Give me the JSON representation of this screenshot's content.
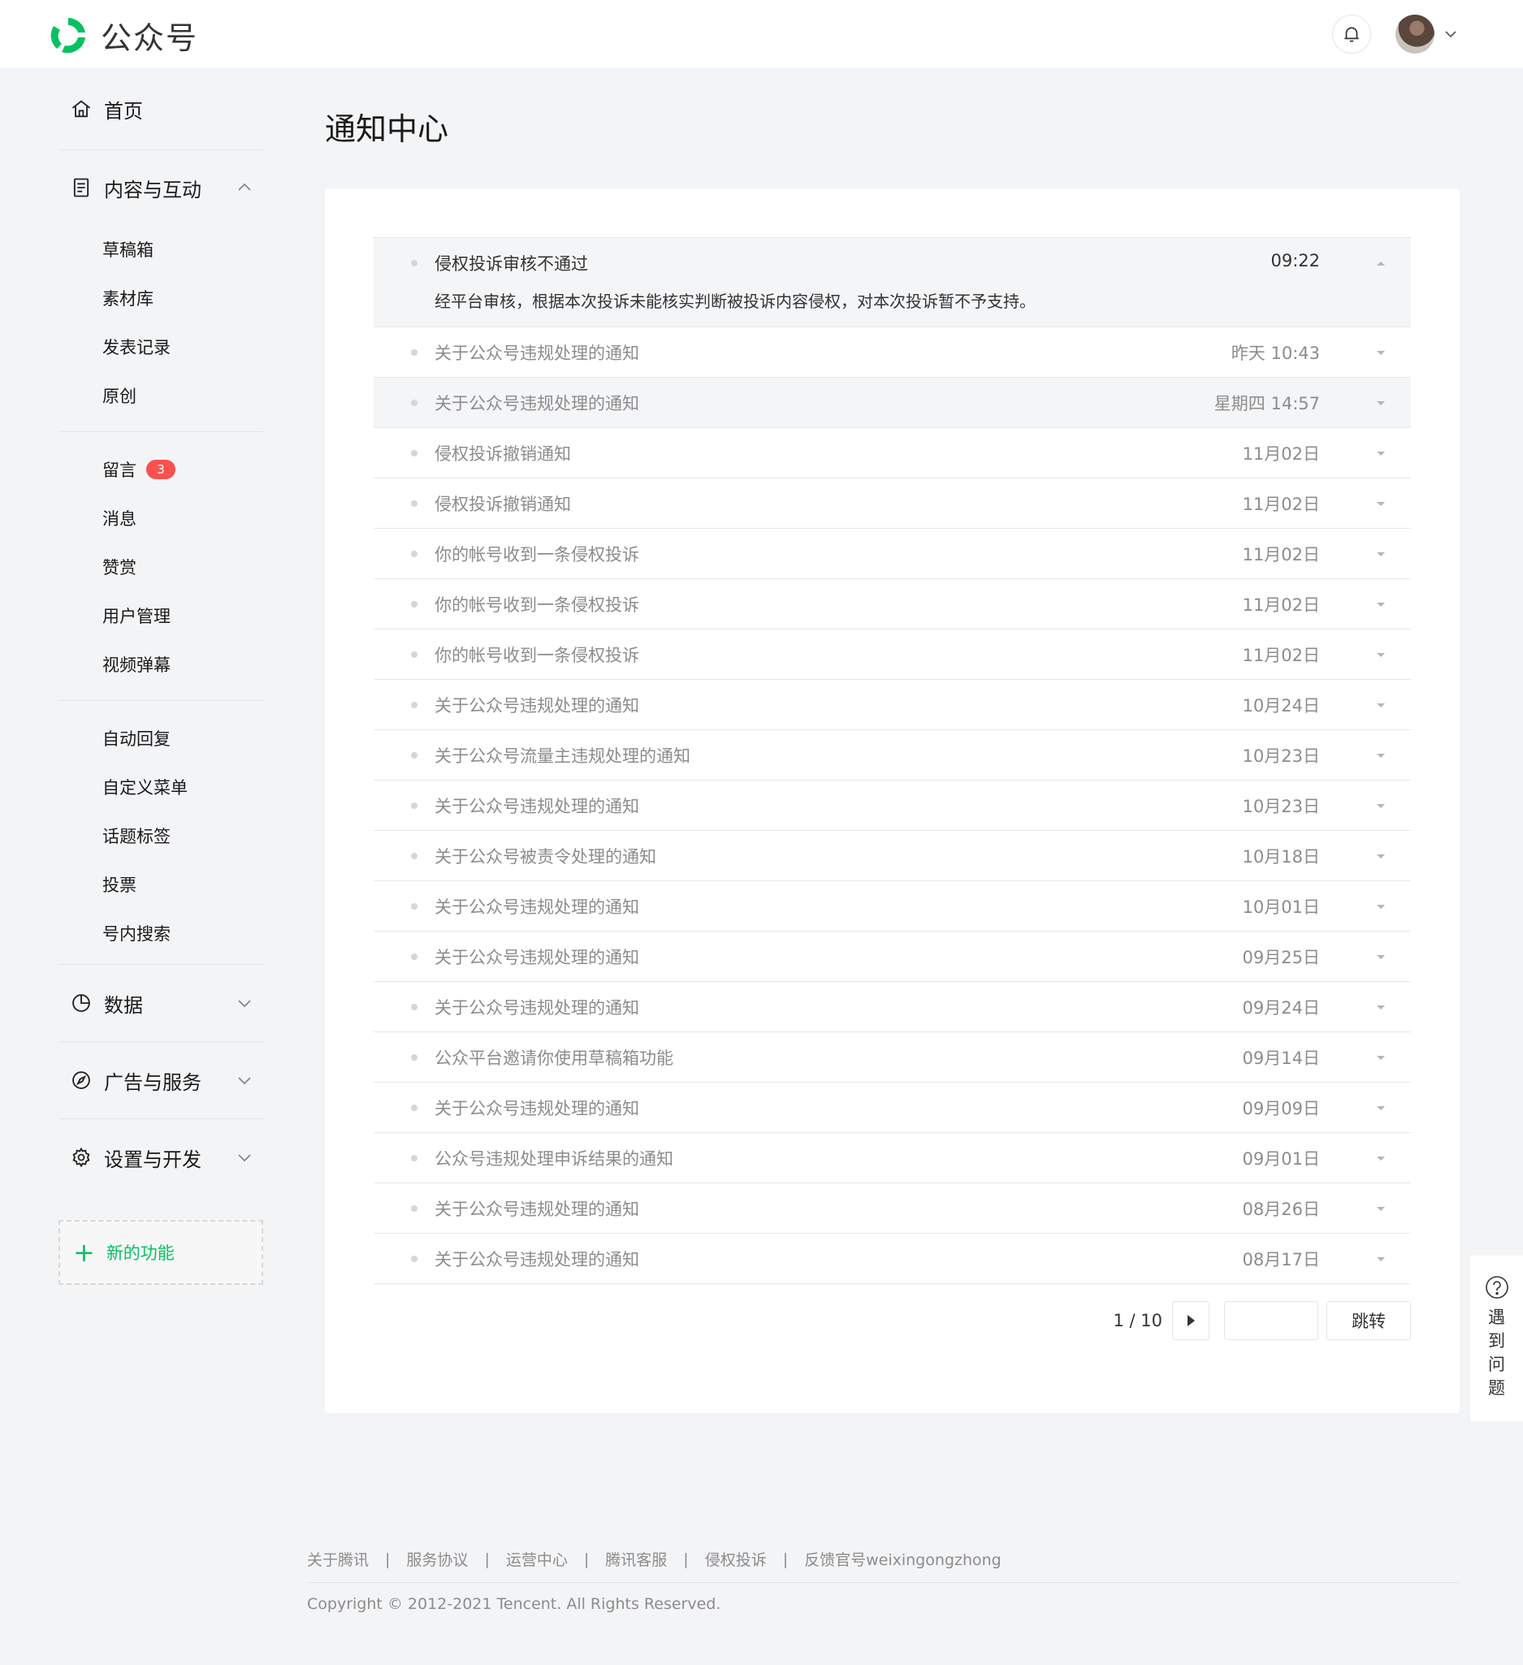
{
  "brand": {
    "name": "公众号"
  },
  "sidebar": {
    "home": "首页",
    "content_group": {
      "label": "内容与互动",
      "section1": [
        "草稿箱",
        "素材库",
        "发表记录",
        "原创"
      ],
      "section2": [
        {
          "label": "留言",
          "badge": "3"
        },
        {
          "label": "消息"
        },
        {
          "label": "赞赏"
        },
        {
          "label": "用户管理"
        },
        {
          "label": "视频弹幕"
        }
      ],
      "section3": [
        "自动回复",
        "自定义菜单",
        "话题标签",
        "投票",
        "号内搜索"
      ]
    },
    "data_group": "数据",
    "ads_group": "广告与服务",
    "settings_group": "设置与开发",
    "new_feature": "新的功能"
  },
  "main": {
    "title": "通知中心",
    "notifications": [
      {
        "title": "侵权投诉审核不通过",
        "time": "09:22",
        "body": "经平台审核，根据本次投诉未能核实判断被投诉内容侵权，对本次投诉暂不予支持。",
        "expanded": true
      },
      {
        "title": "关于公众号违规处理的通知",
        "time": "昨天 10:43"
      },
      {
        "title": "关于公众号违规处理的通知",
        "time": "星期四 14:57",
        "hover": true
      },
      {
        "title": "侵权投诉撤销通知",
        "time": "11月02日"
      },
      {
        "title": "侵权投诉撤销通知",
        "time": "11月02日"
      },
      {
        "title": "你的帐号收到一条侵权投诉",
        "time": "11月02日"
      },
      {
        "title": "你的帐号收到一条侵权投诉",
        "time": "11月02日"
      },
      {
        "title": "你的帐号收到一条侵权投诉",
        "time": "11月02日"
      },
      {
        "title": "关于公众号违规处理的通知",
        "time": "10月24日"
      },
      {
        "title": "关于公众号流量主违规处理的通知",
        "time": "10月23日"
      },
      {
        "title": "关于公众号违规处理的通知",
        "time": "10月23日"
      },
      {
        "title": "关于公众号被责令处理的通知",
        "time": "10月18日"
      },
      {
        "title": "关于公众号违规处理的通知",
        "time": "10月01日"
      },
      {
        "title": "关于公众号违规处理的通知",
        "time": "09月25日"
      },
      {
        "title": "关于公众号违规处理的通知",
        "time": "09月24日"
      },
      {
        "title": "公众平台邀请你使用草稿箱功能",
        "time": "09月14日"
      },
      {
        "title": "关于公众号违规处理的通知",
        "time": "09月09日"
      },
      {
        "title": "公众号违规处理申诉结果的通知",
        "time": "09月01日"
      },
      {
        "title": "关于公众号违规处理的通知",
        "time": "08月26日"
      },
      {
        "title": "关于公众号违规处理的通知",
        "time": "08月17日"
      }
    ],
    "pager": {
      "text": "1 / 10",
      "jump_label": "跳转"
    }
  },
  "help": {
    "label": "遇到问题"
  },
  "footer": {
    "links": [
      "关于腾讯",
      "服务协议",
      "运营中心",
      "腾讯客服",
      "侵权投诉",
      "反馈官号weixingongzhong"
    ],
    "copyright": "Copyright © 2012-2021 Tencent. All Rights Reserved."
  },
  "colors": {
    "brand": "#07c160",
    "badge": "#fa5151"
  }
}
